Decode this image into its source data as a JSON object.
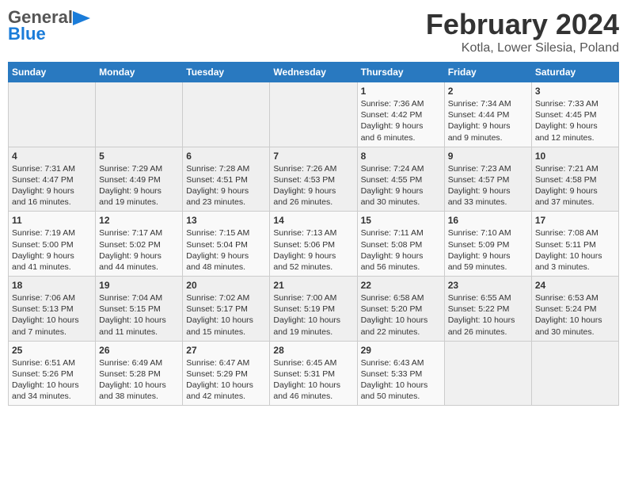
{
  "header": {
    "logo_line1_dark": "General",
    "logo_line2_blue": "Blue",
    "title": "February 2024",
    "subtitle": "Kotla, Lower Silesia, Poland"
  },
  "days_of_week": [
    "Sunday",
    "Monday",
    "Tuesday",
    "Wednesday",
    "Thursday",
    "Friday",
    "Saturday"
  ],
  "weeks": [
    [
      {
        "day": "",
        "info": ""
      },
      {
        "day": "",
        "info": ""
      },
      {
        "day": "",
        "info": ""
      },
      {
        "day": "",
        "info": ""
      },
      {
        "day": "1",
        "info": "Sunrise: 7:36 AM\nSunset: 4:42 PM\nDaylight: 9 hours\nand 6 minutes."
      },
      {
        "day": "2",
        "info": "Sunrise: 7:34 AM\nSunset: 4:44 PM\nDaylight: 9 hours\nand 9 minutes."
      },
      {
        "day": "3",
        "info": "Sunrise: 7:33 AM\nSunset: 4:45 PM\nDaylight: 9 hours\nand 12 minutes."
      }
    ],
    [
      {
        "day": "4",
        "info": "Sunrise: 7:31 AM\nSunset: 4:47 PM\nDaylight: 9 hours\nand 16 minutes."
      },
      {
        "day": "5",
        "info": "Sunrise: 7:29 AM\nSunset: 4:49 PM\nDaylight: 9 hours\nand 19 minutes."
      },
      {
        "day": "6",
        "info": "Sunrise: 7:28 AM\nSunset: 4:51 PM\nDaylight: 9 hours\nand 23 minutes."
      },
      {
        "day": "7",
        "info": "Sunrise: 7:26 AM\nSunset: 4:53 PM\nDaylight: 9 hours\nand 26 minutes."
      },
      {
        "day": "8",
        "info": "Sunrise: 7:24 AM\nSunset: 4:55 PM\nDaylight: 9 hours\nand 30 minutes."
      },
      {
        "day": "9",
        "info": "Sunrise: 7:23 AM\nSunset: 4:57 PM\nDaylight: 9 hours\nand 33 minutes."
      },
      {
        "day": "10",
        "info": "Sunrise: 7:21 AM\nSunset: 4:58 PM\nDaylight: 9 hours\nand 37 minutes."
      }
    ],
    [
      {
        "day": "11",
        "info": "Sunrise: 7:19 AM\nSunset: 5:00 PM\nDaylight: 9 hours\nand 41 minutes."
      },
      {
        "day": "12",
        "info": "Sunrise: 7:17 AM\nSunset: 5:02 PM\nDaylight: 9 hours\nand 44 minutes."
      },
      {
        "day": "13",
        "info": "Sunrise: 7:15 AM\nSunset: 5:04 PM\nDaylight: 9 hours\nand 48 minutes."
      },
      {
        "day": "14",
        "info": "Sunrise: 7:13 AM\nSunset: 5:06 PM\nDaylight: 9 hours\nand 52 minutes."
      },
      {
        "day": "15",
        "info": "Sunrise: 7:11 AM\nSunset: 5:08 PM\nDaylight: 9 hours\nand 56 minutes."
      },
      {
        "day": "16",
        "info": "Sunrise: 7:10 AM\nSunset: 5:09 PM\nDaylight: 9 hours\nand 59 minutes."
      },
      {
        "day": "17",
        "info": "Sunrise: 7:08 AM\nSunset: 5:11 PM\nDaylight: 10 hours\nand 3 minutes."
      }
    ],
    [
      {
        "day": "18",
        "info": "Sunrise: 7:06 AM\nSunset: 5:13 PM\nDaylight: 10 hours\nand 7 minutes."
      },
      {
        "day": "19",
        "info": "Sunrise: 7:04 AM\nSunset: 5:15 PM\nDaylight: 10 hours\nand 11 minutes."
      },
      {
        "day": "20",
        "info": "Sunrise: 7:02 AM\nSunset: 5:17 PM\nDaylight: 10 hours\nand 15 minutes."
      },
      {
        "day": "21",
        "info": "Sunrise: 7:00 AM\nSunset: 5:19 PM\nDaylight: 10 hours\nand 19 minutes."
      },
      {
        "day": "22",
        "info": "Sunrise: 6:58 AM\nSunset: 5:20 PM\nDaylight: 10 hours\nand 22 minutes."
      },
      {
        "day": "23",
        "info": "Sunrise: 6:55 AM\nSunset: 5:22 PM\nDaylight: 10 hours\nand 26 minutes."
      },
      {
        "day": "24",
        "info": "Sunrise: 6:53 AM\nSunset: 5:24 PM\nDaylight: 10 hours\nand 30 minutes."
      }
    ],
    [
      {
        "day": "25",
        "info": "Sunrise: 6:51 AM\nSunset: 5:26 PM\nDaylight: 10 hours\nand 34 minutes."
      },
      {
        "day": "26",
        "info": "Sunrise: 6:49 AM\nSunset: 5:28 PM\nDaylight: 10 hours\nand 38 minutes."
      },
      {
        "day": "27",
        "info": "Sunrise: 6:47 AM\nSunset: 5:29 PM\nDaylight: 10 hours\nand 42 minutes."
      },
      {
        "day": "28",
        "info": "Sunrise: 6:45 AM\nSunset: 5:31 PM\nDaylight: 10 hours\nand 46 minutes."
      },
      {
        "day": "29",
        "info": "Sunrise: 6:43 AM\nSunset: 5:33 PM\nDaylight: 10 hours\nand 50 minutes."
      },
      {
        "day": "",
        "info": ""
      },
      {
        "day": "",
        "info": ""
      }
    ]
  ]
}
